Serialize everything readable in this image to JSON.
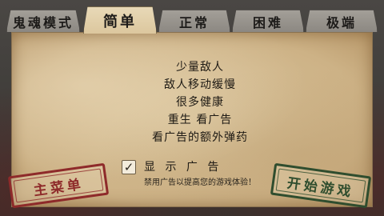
{
  "tabs": [
    {
      "label": "鬼魂模式",
      "active": false
    },
    {
      "label": "简单",
      "active": true
    },
    {
      "label": "正常",
      "active": false
    },
    {
      "label": "困难",
      "active": false
    },
    {
      "label": "极端",
      "active": false
    }
  ],
  "features": [
    "少量敌人",
    "敌人移动缓慢",
    "很多健康",
    "重生 看广告",
    "看广告的额外弹药"
  ],
  "ads_toggle": {
    "checked": true,
    "check_glyph": "✓",
    "label": "显 示 广 告",
    "note": "禁用广告以提高您的游戏体验！"
  },
  "buttons": {
    "main_menu": "主菜单",
    "start_game": "开始游戏"
  },
  "colors": {
    "paper": "#d4bd92",
    "tab_active": "#e2d0aa",
    "tab_inactive": "#9a968f",
    "stamp_red": "#8e2a2a",
    "stamp_green": "#2f4d2e"
  }
}
